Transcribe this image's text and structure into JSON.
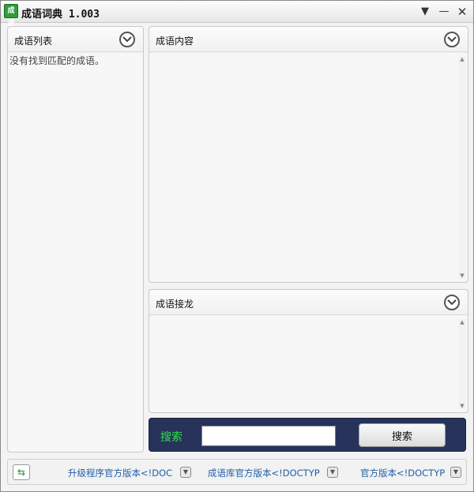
{
  "window": {
    "title": "成语词典 1.003",
    "icon_text": "成语"
  },
  "panels": {
    "list": {
      "title": "成语列表",
      "empty_message": "没有找到匹配的成语。"
    },
    "content": {
      "title": "成语内容"
    },
    "chain": {
      "title": "成语接龙"
    }
  },
  "search": {
    "label": "搜索",
    "input_value": "",
    "button_label": "搜索"
  },
  "footer": {
    "links": [
      {
        "label": "升级程序官方版本<!DOC"
      },
      {
        "label": "成语库官方版本<!DOCTYP"
      },
      {
        "label": "官方版本<!DOCTYP"
      }
    ]
  },
  "icons": {
    "app": "dictionary-app-icon",
    "menu": "dropdown-menu-icon",
    "minimize": "minimize-icon",
    "close": "close-icon",
    "collapse": "chevron-down-circle-icon",
    "refresh": "refresh-icon"
  },
  "colors": {
    "search_bar_bg": "#27335a",
    "search_label": "#2ee04a",
    "link": "#1f5fa8",
    "app_icon": "#2f9e3a"
  }
}
